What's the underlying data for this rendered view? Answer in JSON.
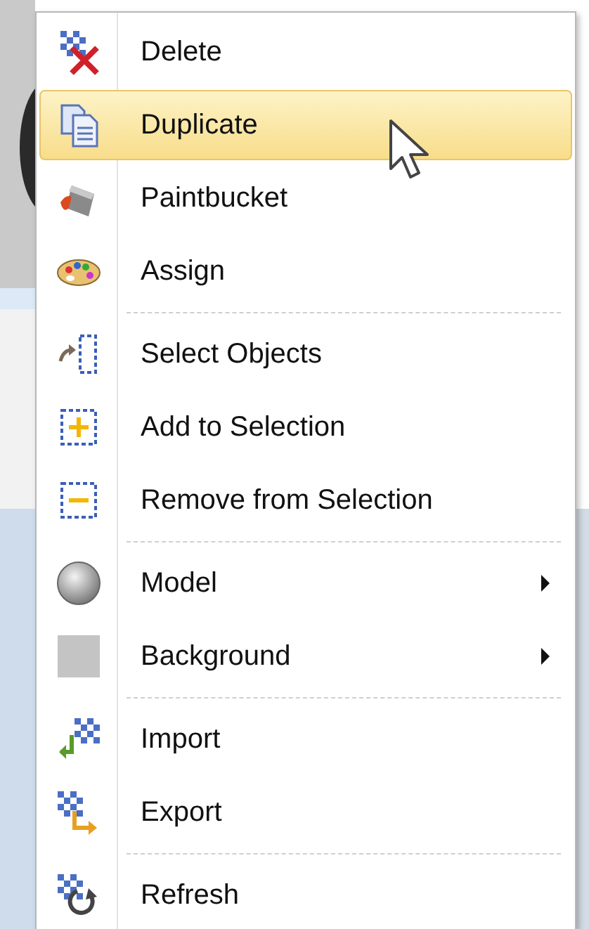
{
  "menu": {
    "items": [
      {
        "kind": "item",
        "label": "Delete",
        "selected": false,
        "submenu": false
      },
      {
        "kind": "item",
        "label": "Duplicate",
        "selected": true,
        "submenu": false
      },
      {
        "kind": "item",
        "label": "Paintbucket",
        "selected": false,
        "submenu": false
      },
      {
        "kind": "item",
        "label": "Assign",
        "selected": false,
        "submenu": false
      },
      {
        "kind": "separator"
      },
      {
        "kind": "item",
        "label": "Select Objects",
        "selected": false,
        "submenu": false
      },
      {
        "kind": "item",
        "label": "Add to Selection",
        "selected": false,
        "submenu": false
      },
      {
        "kind": "item",
        "label": "Remove from Selection",
        "selected": false,
        "submenu": false
      },
      {
        "kind": "separator"
      },
      {
        "kind": "item",
        "label": "Model",
        "selected": false,
        "submenu": true
      },
      {
        "kind": "item",
        "label": "Background",
        "selected": false,
        "submenu": true
      },
      {
        "kind": "separator"
      },
      {
        "kind": "item",
        "label": "Import",
        "selected": false,
        "submenu": false
      },
      {
        "kind": "item",
        "label": "Export",
        "selected": false,
        "submenu": false
      },
      {
        "kind": "separator"
      },
      {
        "kind": "item",
        "label": "Refresh",
        "selected": false,
        "submenu": false
      }
    ]
  }
}
